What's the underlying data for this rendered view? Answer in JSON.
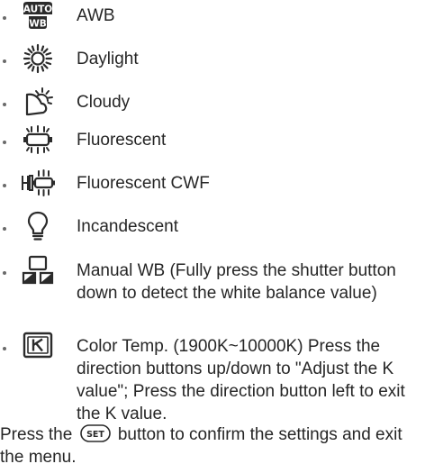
{
  "items": [
    {
      "icon": "auto-wb-icon",
      "label": "AWB"
    },
    {
      "icon": "daylight-icon",
      "label": "Daylight"
    },
    {
      "icon": "cloudy-icon",
      "label": "Cloudy"
    },
    {
      "icon": "fluorescent-icon",
      "label": "Fluorescent"
    },
    {
      "icon": "fluorescent-cwf-icon",
      "label": "Fluorescent CWF"
    },
    {
      "icon": "incandescent-icon",
      "label": "Incandescent"
    },
    {
      "icon": "manual-wb-icon",
      "label": "Manual WB (Fully press the shutter button down to detect the white balance value)"
    },
    {
      "icon": "color-temp-icon",
      "label": "Color Temp. (1900K~10000K) Press the direction buttons up/down to \"Adjust the K value\"; Press the direction button left to exit the K value."
    }
  ],
  "auto_icon_text": {
    "top": "AUTO",
    "bottom": "WB"
  },
  "footer": {
    "before": "Press the",
    "button_text": "SET",
    "after": "button to confirm the settings and exit the menu."
  },
  "colors": {
    "text": "#262626",
    "icon": "#2b2b2b"
  }
}
